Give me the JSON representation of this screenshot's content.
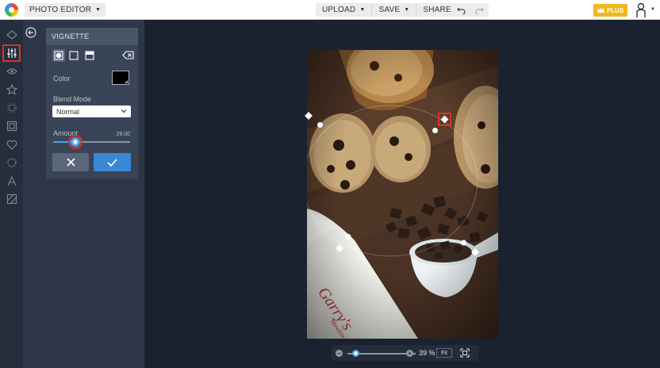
{
  "topbar": {
    "app_menu_label": "PHOTO EDITOR",
    "upload_label": "UPLOAD",
    "save_label": "SAVE",
    "share_label": "SHARE",
    "plus_label": "PLUS"
  },
  "toolbar": {
    "tools": [
      "layers-icon",
      "adjust-icon",
      "eye-icon",
      "star-icon",
      "sparkle-icon",
      "frame-icon",
      "heart-icon",
      "texture-icon",
      "text-icon",
      "graphics-icon"
    ],
    "active_tool": "adjust-icon"
  },
  "panel": {
    "title": "VIGNETTE",
    "color_label": "Color",
    "color_value": "#000000",
    "blend_mode_label": "Blend Mode",
    "blend_mode_value": "Normal",
    "amount_label": "Amount",
    "amount_value": "29.00",
    "amount_fraction": 0.29
  },
  "zoom": {
    "value": "39 %",
    "fit_label": "Fit",
    "fraction": 0.12
  },
  "colors": {
    "accent_blue": "#3a87d6",
    "highlight_red": "#e0302a",
    "plus_yellow": "#f2b71b"
  }
}
